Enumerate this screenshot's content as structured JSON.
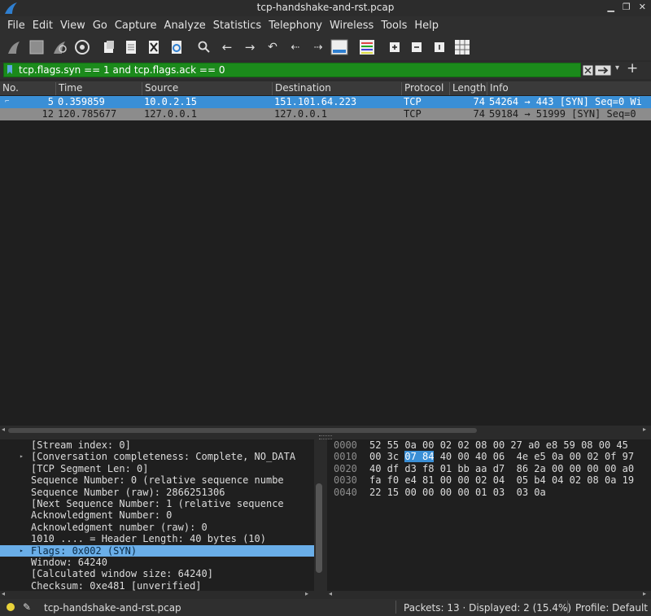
{
  "window": {
    "title": "tcp-handshake-and-rst.pcap",
    "colors": {
      "accent": "#3a8fd6",
      "filter_ok": "#1b8a1b"
    }
  },
  "menu": [
    "File",
    "Edit",
    "View",
    "Go",
    "Capture",
    "Analyze",
    "Statistics",
    "Telephony",
    "Wireless",
    "Tools",
    "Help"
  ],
  "toolbar": [
    "shark-fin-start-icon",
    "stop-capture-icon",
    "restart-capture-icon",
    "capture-options-icon",
    "open-file-icon",
    "save-file-icon",
    "close-file-icon",
    "reload-file-icon",
    "find-packet-icon",
    "go-back-icon",
    "go-forward-icon",
    "go-to-packet-icon",
    "go-first-icon",
    "go-last-icon",
    "autoscroll-icon",
    "colorize-icon",
    "zoom-in-icon",
    "zoom-out-icon",
    "zoom-normal-icon",
    "resize-columns-icon"
  ],
  "filter": {
    "value": "tcp.flags.syn == 1 and tcp.flags.ack == 0"
  },
  "columns": [
    "No.",
    "Time",
    "Source",
    "Destination",
    "Protocol",
    "Length",
    "Info"
  ],
  "packets": [
    {
      "no": "5",
      "time": "0.359859",
      "source": "10.0.2.15",
      "destination": "151.101.64.223",
      "protocol": "TCP",
      "length": "74",
      "info": "54264 → 443 [SYN] Seq=0 Wi"
    },
    {
      "no": "12",
      "time": "120.785677",
      "source": "127.0.0.1",
      "destination": "127.0.0.1",
      "protocol": "TCP",
      "length": "74",
      "info": "59184 → 51999 [SYN] Seq=0"
    }
  ],
  "details": [
    {
      "text": "[Stream index: 0]",
      "exp": false
    },
    {
      "text": "[Conversation completeness: Complete, NO_DATA",
      "exp": true
    },
    {
      "text": "[TCP Segment Len: 0]",
      "exp": false
    },
    {
      "text": "Sequence Number: 0    (relative sequence numbe",
      "exp": false
    },
    {
      "text": "Sequence Number (raw): 2866251306",
      "exp": false
    },
    {
      "text": "[Next Sequence Number: 1    (relative sequence",
      "exp": false
    },
    {
      "text": "Acknowledgment Number: 0",
      "exp": false
    },
    {
      "text": "Acknowledgment number (raw): 0",
      "exp": false
    },
    {
      "text": "1010 .... = Header Length: 40 bytes (10)",
      "exp": false
    },
    {
      "text": "Flags: 0x002 (SYN)",
      "exp": true,
      "hl": true
    },
    {
      "text": "Window: 64240",
      "exp": false
    },
    {
      "text": "[Calculated window size: 64240]",
      "exp": false
    },
    {
      "text": "Checksum: 0xe481 [unverified]",
      "exp": false
    }
  ],
  "bytes": [
    {
      "off": "0000",
      "pre": "52 55 0a 00 02 02 08 00  27 a0 e8 59 08 00 45",
      "sel": "",
      "post": ""
    },
    {
      "off": "0010",
      "pre": "00 3c ",
      "sel": "07 84",
      "post": " 40 00 40 06  4e e5 0a 00 02 0f 97"
    },
    {
      "off": "0020",
      "pre": "40 df d3 f8 01 bb aa d7  86 2a 00 00 00 00 a0",
      "sel": "",
      "post": ""
    },
    {
      "off": "0030",
      "pre": "fa f0 e4 81 00 00 02 04  05 b4 04 02 08 0a 19",
      "sel": "",
      "post": ""
    },
    {
      "off": "0040",
      "pre": "22 15 00 00 00 00 01 03  03 0a",
      "sel": "",
      "post": ""
    }
  ],
  "status": {
    "file": "tcp-handshake-and-rst.pcap",
    "packets": "Packets: 13 · Displayed: 2 (15.4%)",
    "profile": "Profile: Default"
  }
}
